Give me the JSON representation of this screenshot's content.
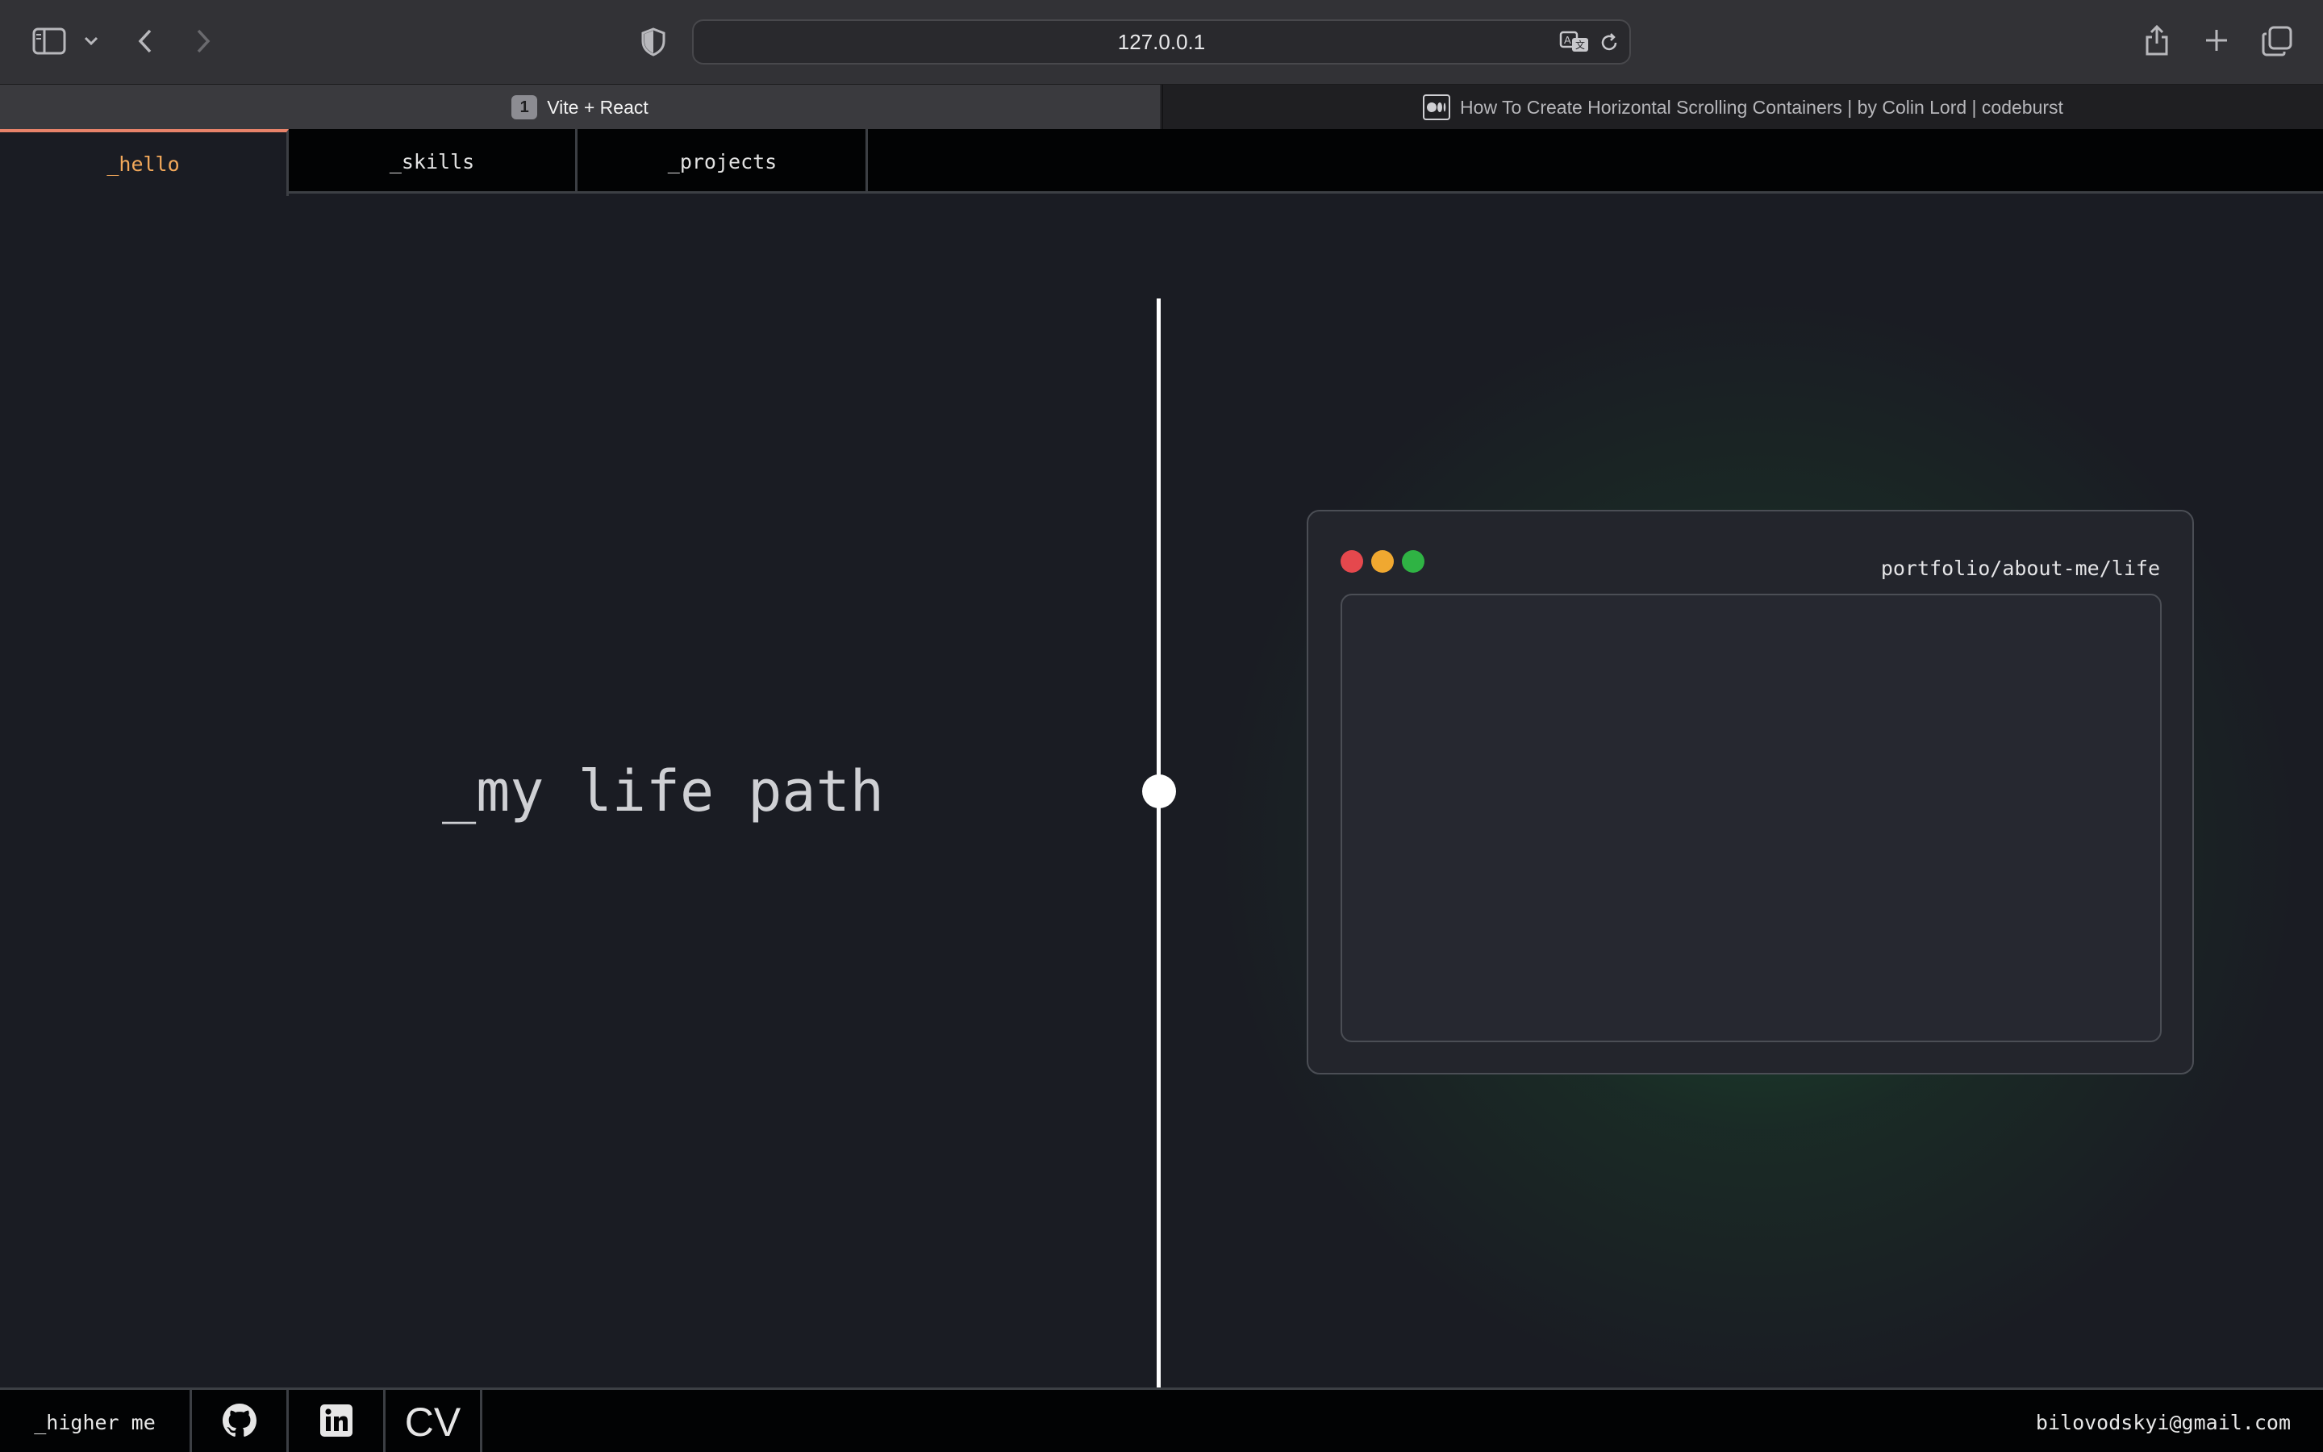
{
  "browser": {
    "url": "127.0.0.1",
    "tabs": [
      {
        "badge": "1",
        "title": "Vite + React"
      },
      {
        "title": "How To Create Horizontal Scrolling Containers | by Colin Lord | codeburst"
      }
    ],
    "icons": [
      "sidebar-icon",
      "chevron-down-icon",
      "back-icon",
      "forward-icon",
      "shield-icon",
      "translate-icon",
      "reload-icon",
      "share-icon",
      "plus-icon",
      "tabs-overview-icon",
      "medium-icon"
    ]
  },
  "nav": {
    "tabs": [
      {
        "label": "_hello"
      },
      {
        "label": "_skills"
      },
      {
        "label": "_projects"
      }
    ],
    "active": "_hello"
  },
  "main": {
    "headline": "_my life path",
    "window": {
      "path": "portfolio/about-me/life"
    },
    "compare_slider_position": 0.5
  },
  "footer": {
    "tagline": "_higher me",
    "cv_label": "CV",
    "email": "bilovodskyi@gmail.com",
    "icons": [
      "github-icon",
      "linkedin-icon"
    ]
  },
  "colors": {
    "accent_active_tab_text": "#f2a85a",
    "accent_active_tab_border": "#e8836a",
    "page_bg": "#1a1c23",
    "glow": "#1e783c",
    "traffic_red": "#e5484d",
    "traffic_yellow": "#f0a830",
    "traffic_green": "#2fb344"
  }
}
